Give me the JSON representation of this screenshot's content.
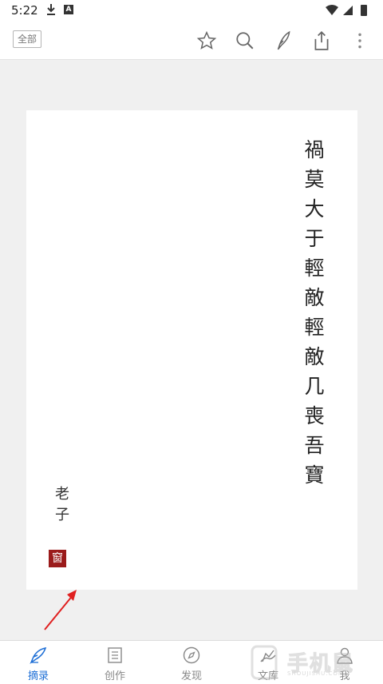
{
  "status": {
    "time": "5:22",
    "font_badge": "A"
  },
  "toolbar": {
    "filter_label": "全部",
    "icons": [
      "star-icon",
      "search-icon",
      "feather-pen-icon",
      "share-icon",
      "more-vertical-icon"
    ]
  },
  "card": {
    "poem": "禍莫大于輕敵輕敵几喪吾寶",
    "author": "老子",
    "seal": "窗"
  },
  "bottom_nav": {
    "items": [
      {
        "label": "摘录",
        "icon": "quill-icon",
        "active": true
      },
      {
        "label": "创作",
        "icon": "document-icon",
        "active": false
      },
      {
        "label": "发现",
        "icon": "compass-icon",
        "active": false
      },
      {
        "label": "文库",
        "icon": "library-icon",
        "active": false
      },
      {
        "label": "我",
        "icon": "user-icon",
        "active": false
      }
    ]
  },
  "watermark": {
    "text": "手机鼠",
    "sub": "SHOUJISHU.COM"
  },
  "colors": {
    "accent": "#1e6fd6",
    "seal": "#9b1b1b",
    "arrow": "#e02020"
  }
}
